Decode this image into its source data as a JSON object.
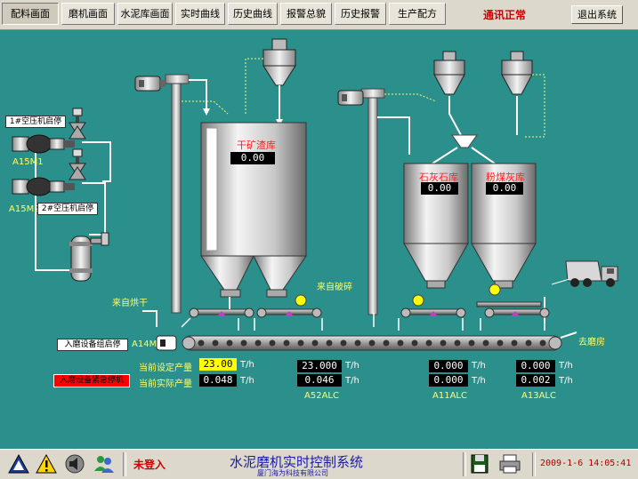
{
  "nav": {
    "tabs": [
      "配料画面",
      "磨机画面",
      "水泥库画面",
      "实时曲线",
      "历史曲线",
      "报警总貌",
      "历史报警",
      "生产配方"
    ],
    "comm_status": "通讯正常",
    "exit_label": "退出系统"
  },
  "process": {
    "compressor1_btn": "1#空压机启停",
    "compressor2_btn": "2#空压机启停",
    "a15m1": "A15M1",
    "a15m2": "A15M2",
    "from_dryer": "来自烘干",
    "from_crusher": "来自破碎",
    "bin1_name": "干矿渣库",
    "bin1_value": "0.00",
    "bin2_name": "石灰石库",
    "bin2_value": "0.00",
    "bin3_name": "粉煤灰库",
    "bin3_value": "0.00",
    "a14m": "A14M",
    "group_start_btn": "入磨设备组启停",
    "emergency_btn": "入磨设备紧急停机",
    "to_mill": "去磨房",
    "set_output_label": "当前设定产量",
    "actual_output_label": "当前实际产量",
    "set_output_value": "23.00",
    "actual_output_value": "0.048",
    "unit": "T/h",
    "a52_set": "23.000",
    "a52_actual": "0.046",
    "a52_name": "A52ALC",
    "a11_set": "0.000",
    "a11_actual": "0.000",
    "a11_name": "A11ALC",
    "a13_set": "0.000",
    "a13_actual": "0.002",
    "a13_name": "A13ALC"
  },
  "footer": {
    "login_status": "未登入",
    "system_title": "水泥磨机实时控制系统",
    "company": "厦门海为科技有限公司",
    "datetime": "2009-1-6 14:05:41"
  },
  "colors": {
    "background": "#2b8f8b",
    "alarm_red": "#ff0000",
    "setpoint_yellow": "#ffff00",
    "active_indicator": "#ffff00",
    "valve_magenta": "#c040c0"
  }
}
